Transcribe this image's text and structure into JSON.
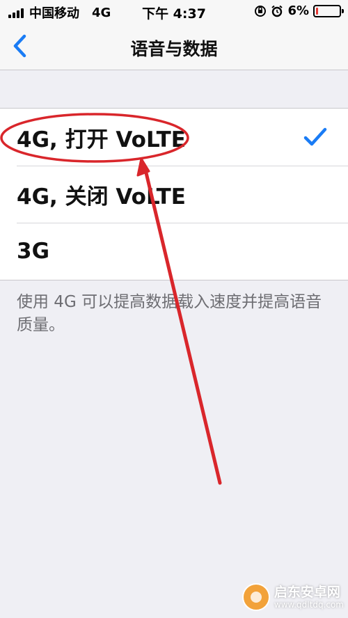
{
  "status_bar": {
    "carrier": "中国移动",
    "network": "4G",
    "time": "下午 4:37",
    "battery_percent": "6%",
    "battery_level": 0.06,
    "battery_color": "#e53935",
    "icons": [
      "signal-icon",
      "orientation-lock-icon",
      "alarm-icon",
      "battery-icon"
    ]
  },
  "nav": {
    "back_icon": "chevron-left-icon",
    "title": "语音与数据",
    "accent_color": "#1a7cf5"
  },
  "options": [
    {
      "label": "4G, 打开 VoLTE",
      "selected": true
    },
    {
      "label": "4G, 关闭 VoLTE",
      "selected": false
    },
    {
      "label": "3G",
      "selected": false
    }
  ],
  "footer_note": "使用 4G 可以提高数据载入速度并提高语音质量。",
  "annotation": {
    "color": "#d9262b",
    "shapes": [
      "highlight-oval",
      "pointer-arrow"
    ]
  },
  "watermark": {
    "name": "启东安卓网",
    "url": "www.qdltdq.com"
  }
}
